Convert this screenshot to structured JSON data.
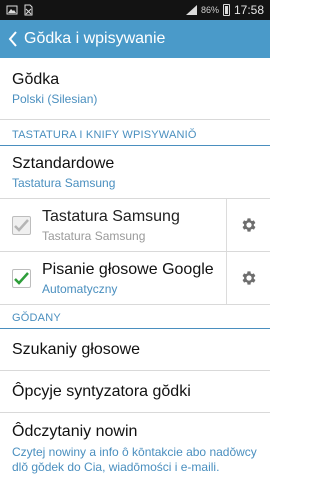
{
  "status_bar": {
    "battery_text": "86%",
    "time": "17:58"
  },
  "action_bar": {
    "title": "Gŏdka i wpisywanie"
  },
  "language": {
    "title": "Gŏdka",
    "summary": "Polski (Silesian)"
  },
  "section_keyboards": {
    "header": "TASTATURA I KNIFY WPISYWANIŎ"
  },
  "default_keyboard": {
    "title": "Sztandardowe",
    "summary": "Tastatura Samsung"
  },
  "samsung_keyboard": {
    "title": "Tastatura Samsung",
    "summary": "Tastatura Samsung",
    "checked": true,
    "enabled": false
  },
  "google_voice": {
    "title": "Pisanie głosowe Google",
    "summary": "Automatyczny",
    "checked": true,
    "enabled": true
  },
  "section_speech": {
    "header": "GŎDANY"
  },
  "voice_search": {
    "title": "Szukaniy głosowe"
  },
  "tts_options": {
    "title": "Ôpcyje syntyzatora gŏdki"
  },
  "notifications_read": {
    "title": "Ôdczytaniy nowin",
    "summary": "Czytej nowiny a info ô kōntakcie abo nadŏwcy dlŏ gŏdek do Cia, wiadōmości i e-maili."
  },
  "colors": {
    "accent": "#4a9ac9",
    "summary": "#4a8fbf",
    "check_green": "#2e9e3a",
    "check_disabled": "#b5b5b5"
  }
}
